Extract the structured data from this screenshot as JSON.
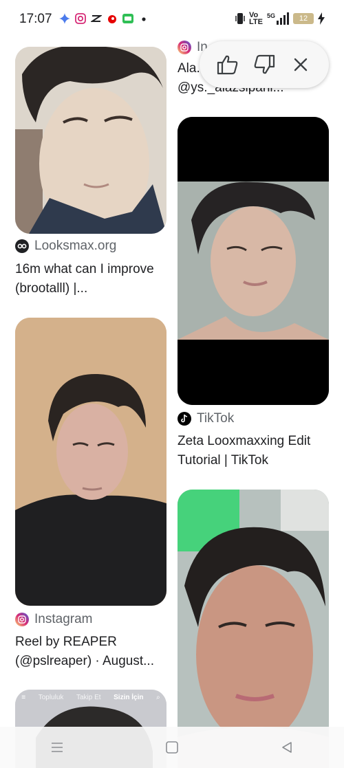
{
  "status_bar": {
    "time": "17:07",
    "network_label_top": "Vo",
    "network_label_bottom": "LTE",
    "signal_label": "5G",
    "battery": "12"
  },
  "feedback": {
    "icons": [
      "thumbs-up-icon",
      "thumbs-down-icon",
      "close-icon"
    ]
  },
  "results": {
    "left": [
      {
        "source": "Looksmax.org",
        "title": "16m what can I improve (brootalll) |...",
        "source_icon": "looksmax-icon"
      },
      {
        "source": "Instagram",
        "title": "Reel by REAPER (@pslreaper) · August...",
        "source_icon": "instagram-icon"
      },
      {
        "overlay_tabs": [
          "Topluluk",
          "Takip Et",
          "Sizin İçin"
        ]
      }
    ],
    "right": [
      {
        "source": "In",
        "title": "Ala. @ys._alazsipani...",
        "source_icon": "instagram-icon"
      },
      {
        "source": "TikTok",
        "title": "Zeta Looxmaxxing Edit Tutorial | TikTok",
        "source_icon": "tiktok-icon"
      }
    ]
  },
  "colors": {
    "instagram": "#d62976",
    "tiktok": "#000000",
    "pill_bg": "#f7f7f7"
  }
}
